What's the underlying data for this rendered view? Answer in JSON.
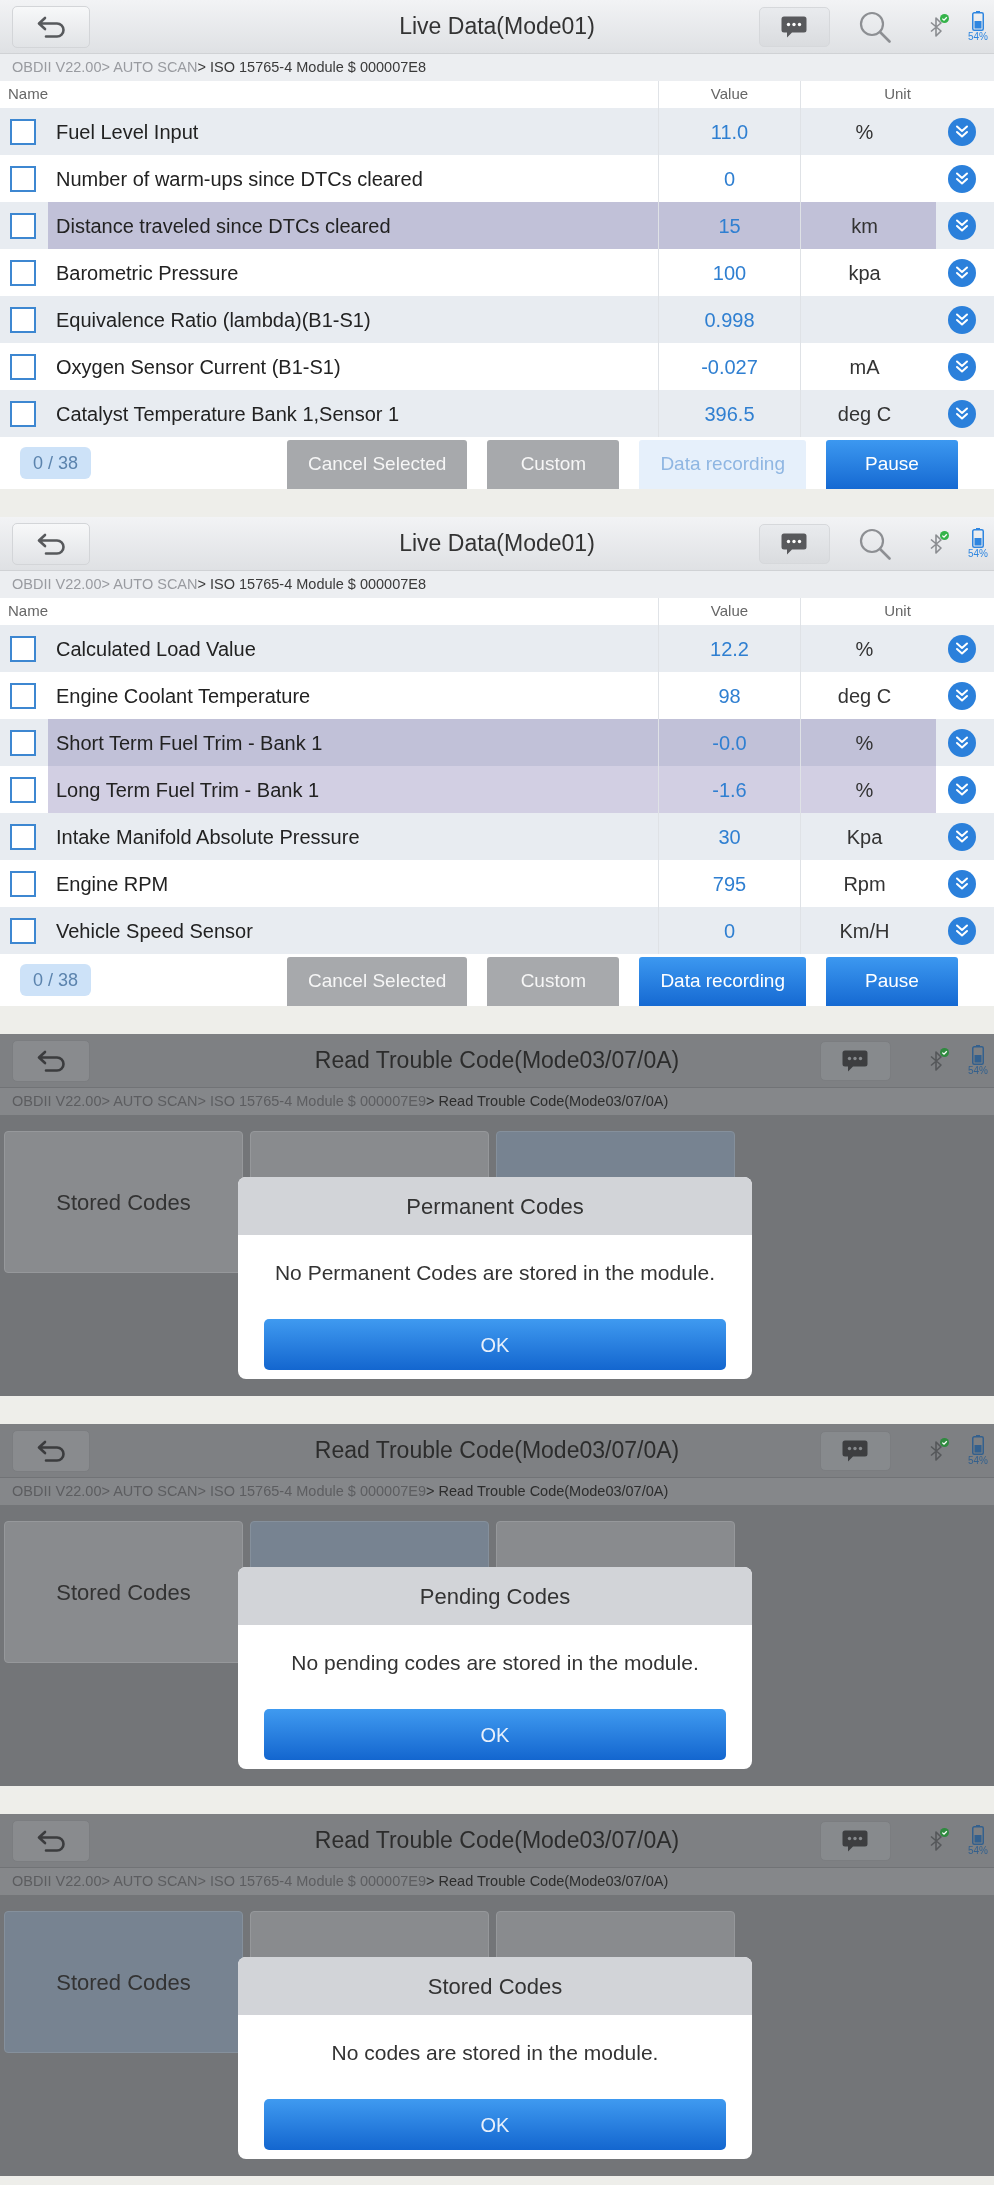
{
  "screens": [
    {
      "kind": "live_data",
      "header": {
        "title": "Live Data(Mode01)",
        "search": true,
        "battery": "54%"
      },
      "breadcrumb": {
        "trail": "OBDII V22.00> AUTO SCAN",
        "current": "> ISO 15765-4 Module $ 000007E8"
      },
      "columns": [
        "Name",
        "Value",
        "Unit"
      ],
      "rows": [
        {
          "name": "Fuel Level Input",
          "value": "11.0",
          "unit": "%",
          "checked": false,
          "highlighted": false
        },
        {
          "name": "Number of warm-ups since DTCs cleared",
          "value": "0",
          "checked": false,
          "highlighted": false
        },
        {
          "name": "Distance traveled since DTCs cleared",
          "value": "15",
          "unit": "km",
          "checked": false,
          "highlighted": true
        },
        {
          "name": "Barometric Pressure",
          "value": "100",
          "unit": "kpa",
          "checked": false,
          "highlighted": false
        },
        {
          "name": "Equivalence Ratio (lambda)(B1-S1)",
          "value": "0.998",
          "checked": false,
          "highlighted": false
        },
        {
          "name": "Oxygen Sensor Current (B1-S1)",
          "value": "-0.027",
          "unit": "mA",
          "checked": false,
          "highlighted": false
        },
        {
          "name": "Catalyst Temperature Bank 1,Sensor 1",
          "value": "396.5",
          "unit": "deg C",
          "checked": false,
          "highlighted": false
        }
      ],
      "counter": "0 / 38",
      "buttons": [
        {
          "label": "Cancel Selected",
          "kind": "secondary",
          "disabled": false
        },
        {
          "label": "Custom",
          "kind": "secondary",
          "disabled": false
        },
        {
          "label": "Data recording",
          "kind": "primary",
          "disabled": true
        },
        {
          "label": "Pause",
          "kind": "primary",
          "disabled": false
        }
      ]
    },
    {
      "kind": "live_data",
      "header": {
        "title": "Live Data(Mode01)",
        "search": true,
        "battery": "54%"
      },
      "breadcrumb": {
        "trail": "OBDII V22.00> AUTO SCAN",
        "current": "> ISO 15765-4 Module $ 000007E8"
      },
      "columns": [
        "Name",
        "Value",
        "Unit"
      ],
      "rows": [
        {
          "name": "Calculated Load Value",
          "value": "12.2",
          "unit": "%",
          "checked": false,
          "highlighted": false
        },
        {
          "name": "Engine Coolant Temperature",
          "value": "98",
          "unit": "deg C",
          "checked": false,
          "highlighted": false
        },
        {
          "name": "Short Term Fuel Trim - Bank 1",
          "value": "-0.0",
          "unit": "%",
          "checked": false,
          "highlighted": true
        },
        {
          "name": "Long Term Fuel Trim - Bank 1",
          "value": "-1.6",
          "unit": "%",
          "checked": false,
          "highlighted": true
        },
        {
          "name": "Intake Manifold Absolute Pressure",
          "value": "30",
          "unit": "Kpa",
          "checked": false,
          "highlighted": false
        },
        {
          "name": "Engine RPM",
          "value": "795",
          "unit": "Rpm",
          "checked": false,
          "highlighted": false
        },
        {
          "name": "Vehicle Speed Sensor",
          "value": "0",
          "unit": "Km/H",
          "checked": false,
          "highlighted": false
        }
      ],
      "counter": "0 / 38",
      "buttons": [
        {
          "label": "Cancel Selected",
          "kind": "secondary",
          "disabled": false
        },
        {
          "label": "Custom",
          "kind": "secondary",
          "disabled": false
        },
        {
          "label": "Data recording",
          "kind": "primary",
          "disabled": false
        },
        {
          "label": "Pause",
          "kind": "primary",
          "disabled": false
        }
      ]
    },
    {
      "kind": "trouble_codes",
      "header": {
        "title": "Read Trouble Code(Mode03/07/0A)",
        "search": false,
        "battery": "54%"
      },
      "breadcrumb": {
        "trail": "OBDII V22.00> AUTO SCAN> ISO 15765-4 Module $ 000007E9",
        "current": "> Read Trouble Code(Mode03/07/0A)"
      },
      "tiles": [
        {
          "label": "Stored Codes",
          "selected": false
        },
        {
          "selected": false
        },
        {
          "selected": true
        }
      ],
      "dialog": {
        "title": "Permanent Codes",
        "message": "No Permanent Codes are stored in the module.",
        "button": "OK"
      }
    },
    {
      "kind": "trouble_codes",
      "header": {
        "title": "Read Trouble Code(Mode03/07/0A)",
        "search": false,
        "battery": "54%"
      },
      "breadcrumb": {
        "trail": "OBDII V22.00> AUTO SCAN> ISO 15765-4 Module $ 000007E9",
        "current": "> Read Trouble Code(Mode03/07/0A)"
      },
      "tiles": [
        {
          "label": "Stored Codes",
          "selected": false
        },
        {
          "selected": true
        },
        {
          "selected": false
        }
      ],
      "dialog": {
        "title": "Pending Codes",
        "message": "No pending codes are stored in the module.",
        "button": "OK"
      }
    },
    {
      "kind": "trouble_codes",
      "header": {
        "title": "Read Trouble Code(Mode03/07/0A)",
        "search": false,
        "battery": "54%"
      },
      "breadcrumb": {
        "trail": "OBDII V22.00> AUTO SCAN> ISO 15765-4 Module $ 000007E9",
        "current": "> Read Trouble Code(Mode03/07/0A)"
      },
      "tiles": [
        {
          "label": "Stored Codes",
          "selected": true
        },
        {
          "selected": false
        },
        {
          "selected": false
        }
      ],
      "dialog": {
        "title": "Stored Codes",
        "message": "No codes are stored in the module.",
        "button": "OK"
      }
    }
  ]
}
